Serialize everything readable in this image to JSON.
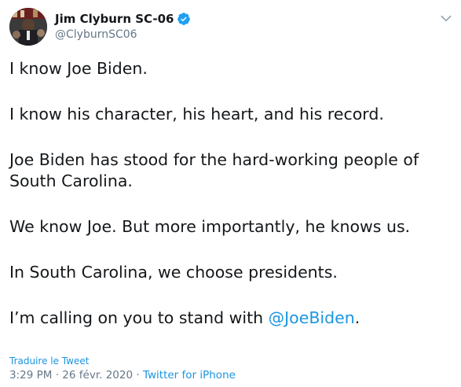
{
  "author": {
    "display_name": "Jim Clyburn SC-06",
    "handle": "@ClyburnSC06",
    "verified": true
  },
  "icons": {
    "avatar": "profile-photo",
    "verified": "verified-badge-icon",
    "menu": "chevron-down-icon"
  },
  "tweet": {
    "line1": "I know Joe Biden.",
    "line2": "I know his character, his heart, and his record.",
    "line3": "Joe Biden has stood for the hard-working people of South Carolina.",
    "line4": "We know Joe. But more importantly, he knows us.",
    "line5": "In South Carolina, we choose presidents.",
    "line6_prefix": "I’m calling on you to stand with ",
    "line6_mention": "@JoeBiden",
    "line6_suffix": "."
  },
  "footer": {
    "translate_label": "Traduire le Tweet",
    "time": "3:29 PM",
    "date": "26 févr. 2020",
    "separator": "·",
    "source": "Twitter for iPhone"
  },
  "colors": {
    "link": "#1b95e0",
    "text": "#14171a",
    "secondary": "#657786"
  }
}
